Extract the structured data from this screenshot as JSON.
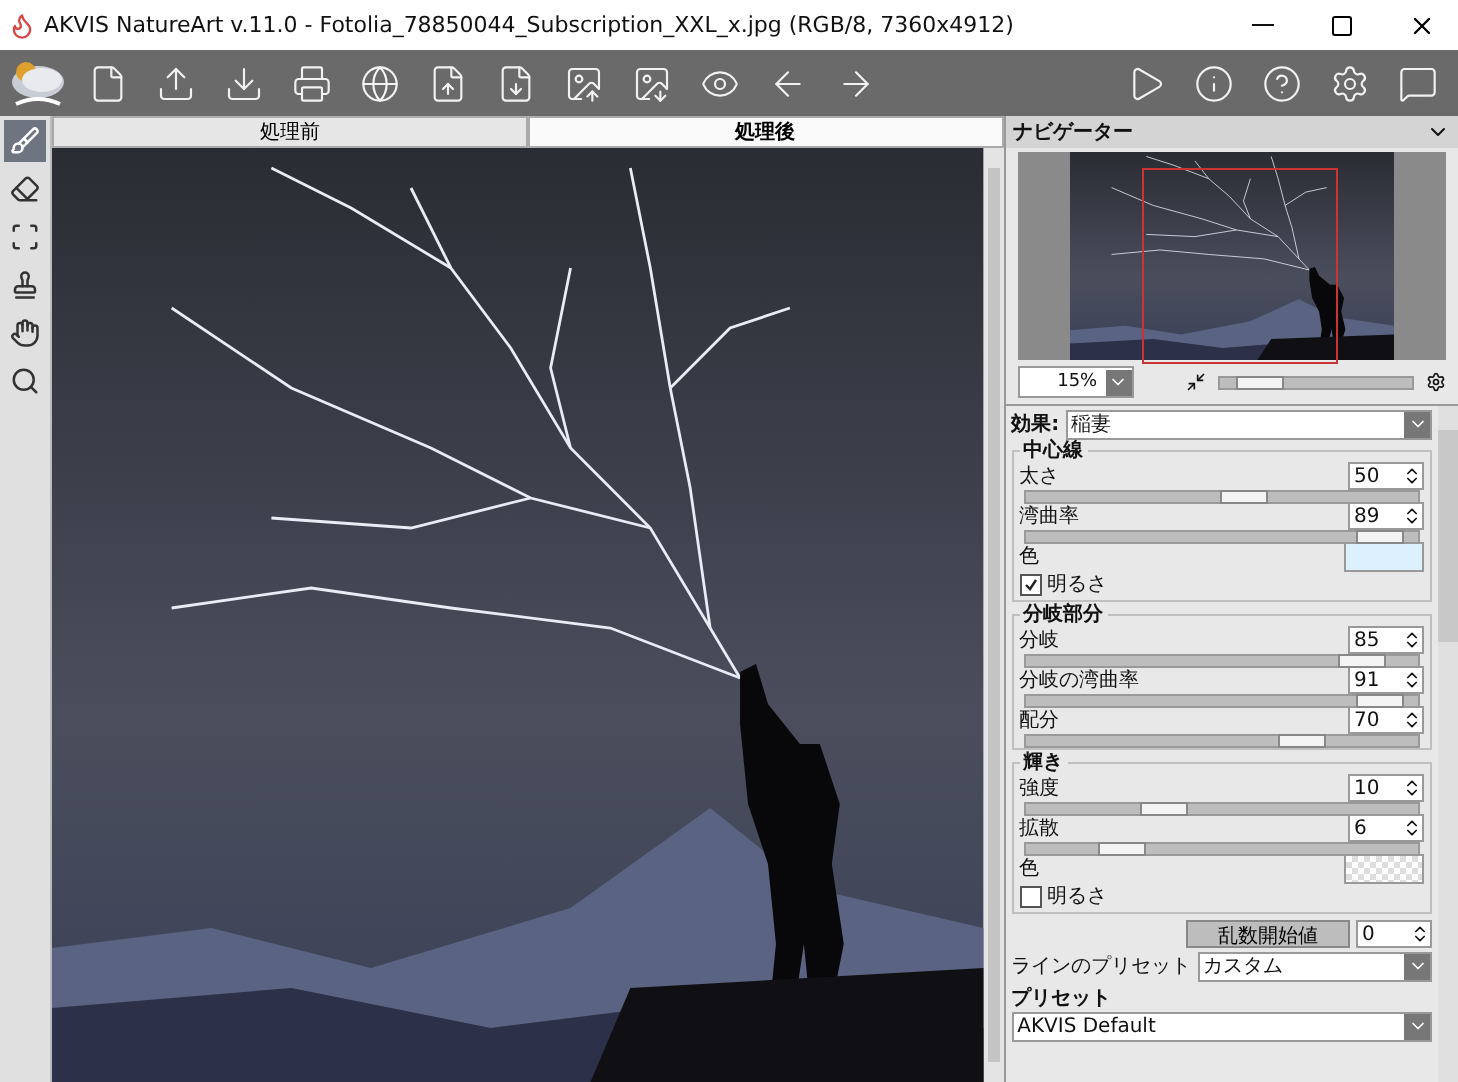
{
  "window": {
    "title": "AKVIS NatureArt v.11.0 - Fotolia_78850044_Subscription_XXL_x.jpg (RGB/8, 7360x4912)"
  },
  "left_tools": [
    {
      "kind": "brush",
      "selected": true
    },
    {
      "kind": "eraser",
      "selected": false
    },
    {
      "kind": "crop",
      "selected": false
    },
    {
      "kind": "stamp",
      "selected": false
    },
    {
      "kind": "hand",
      "selected": false
    },
    {
      "kind": "zoom",
      "selected": false
    }
  ],
  "tabs": [
    {
      "label": "処理前",
      "selected": false
    },
    {
      "label": "処理後",
      "selected": true
    }
  ],
  "navigator": {
    "title": "ナビゲーター",
    "zoom": "15%",
    "level": 0.2
  },
  "effect": {
    "label": "効果:",
    "value": "稲妻"
  },
  "groups": [
    {
      "title": "中心線",
      "items": [
        {
          "kind": "slider",
          "label": "太さ",
          "value": "50",
          "level": 0.55
        },
        {
          "kind": "slider",
          "label": "湾曲率",
          "value": "89",
          "level": 0.9
        },
        {
          "kind": "color",
          "label": "色",
          "color": "#ddf0fd"
        },
        {
          "kind": "checkbox",
          "label": "明るさ",
          "checked": true
        }
      ]
    },
    {
      "title": "分岐部分",
      "items": [
        {
          "kind": "slider",
          "label": "分岐",
          "value": "85",
          "level": 0.85
        },
        {
          "kind": "slider",
          "label": "分岐の湾曲率",
          "value": "91",
          "level": 0.9
        },
        {
          "kind": "slider",
          "label": "配分",
          "value": "70",
          "level": 0.7
        }
      ]
    },
    {
      "title": "輝き",
      "items": [
        {
          "kind": "slider",
          "label": "強度",
          "value": "10",
          "level": 0.35
        },
        {
          "kind": "slider",
          "label": "拡散",
          "value": "6",
          "level": 0.24
        },
        {
          "kind": "color",
          "label": "色"
        },
        {
          "kind": "checkbox",
          "label": "明るさ",
          "checked": false
        }
      ]
    }
  ],
  "random_seed": {
    "button": "乱数開始値",
    "value": "0"
  },
  "line_preset": {
    "label": "ラインのプリセット",
    "value": "カスタム"
  },
  "presets": {
    "title": "プリセット",
    "value": "AKVIS Default"
  }
}
